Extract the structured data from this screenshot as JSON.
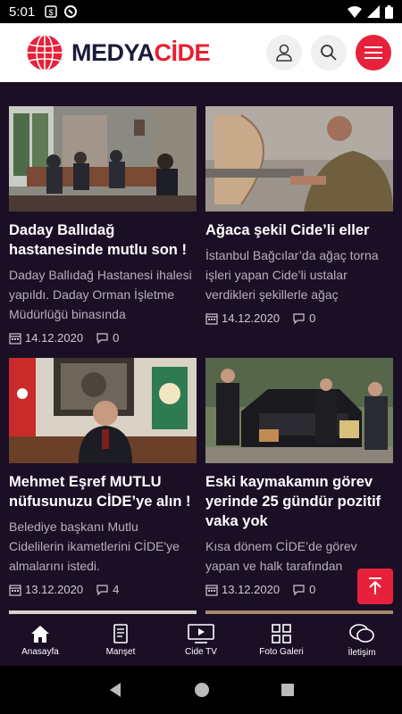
{
  "status_bar": {
    "time": "5:01"
  },
  "header": {
    "logo_part1": "MEDYA",
    "logo_part2": "CİDE"
  },
  "articles": [
    {
      "title": "Daday Ballıdağ hastanesinde mutlu son !",
      "excerpt": "Daday Ballıdağ Hastanesi ihalesi yapıldı. Daday Orman İşletme Müdürlüğü binasında",
      "date": "14.12.2020",
      "comments": "0"
    },
    {
      "title": "Ağaca şekil Cide’li eller",
      "excerpt": "İstanbul Bağcılar’da ağaç torna işleri yapan Cide’li ustalar verdikleri şekillerle ağaç gövdelerini eşsiz bir sanat",
      "date": "14.12.2020",
      "comments": "0"
    },
    {
      "title": "Mehmet Eşref MUTLU nüfusunuzu CİDE’ye alın !",
      "excerpt": "Belediye başkanı Mutlu Cidelilerin ikametlerini CİDE'ye almalarını istedi.",
      "date": "13.12.2020",
      "comments": "4"
    },
    {
      "title": "Eski kaymakamın görev yerinde 25 gündür pozitif vaka yok",
      "excerpt": "Kısa dönem CİDE’de görev yapan ve halk tarafından",
      "date": "13.12.2020",
      "comments": "0"
    }
  ],
  "bottom_nav": [
    {
      "label": "Anasayfa",
      "icon": "home-icon"
    },
    {
      "label": "Manşet",
      "icon": "document-icon"
    },
    {
      "label": "Cide TV",
      "icon": "tv-icon"
    },
    {
      "label": "Foto Galeri",
      "icon": "gallery-icon"
    },
    {
      "label": "İletişim",
      "icon": "chat-icon"
    }
  ],
  "colors": {
    "background": "#1b0f26",
    "accent": "#e8213a"
  }
}
